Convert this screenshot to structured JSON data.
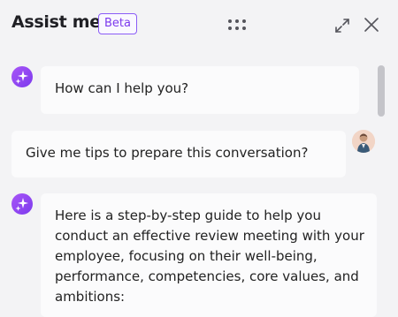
{
  "header": {
    "title": "Assist me",
    "badge": "Beta",
    "drag_icon": "drag-handle-dots-icon",
    "expand_icon": "expand-arrows-icon",
    "close_icon": "close-icon"
  },
  "messages": [
    {
      "sender": "assistant",
      "avatar_icon": "sparkle-icon",
      "text": "How can I help you?"
    },
    {
      "sender": "user",
      "avatar_icon": "user-photo",
      "text": "Give me tips to prepare this conversation?"
    },
    {
      "sender": "assistant",
      "avatar_icon": "sparkle-icon",
      "text": "Here is a step-by-step guide to help you conduct an effective review meeting with your employee, focusing on their well-being, performance, competencies, core values, and ambitions:"
    }
  ],
  "colors": {
    "accent": "#8b5cf6",
    "background": "#f3f3f5",
    "bubble": "#fbfbfc"
  }
}
